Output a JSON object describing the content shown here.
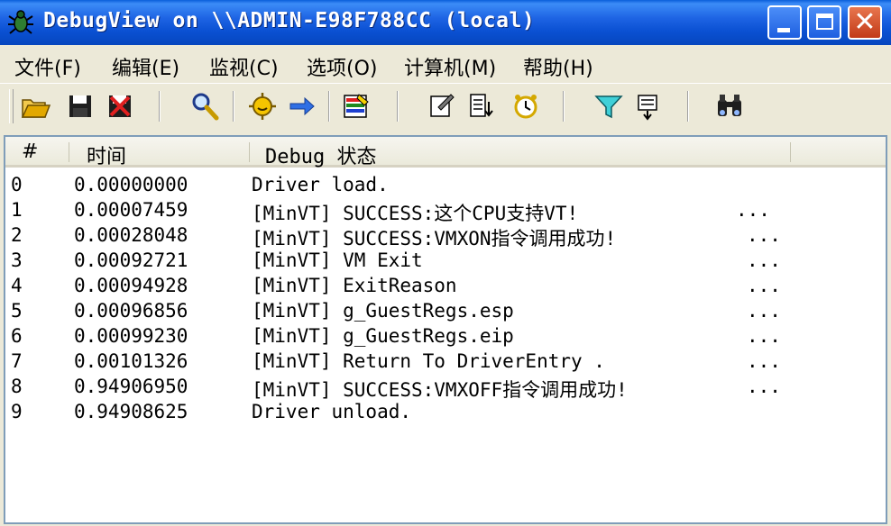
{
  "window": {
    "title": "DebugView on \\\\ADMIN-E98F788CC (local)"
  },
  "menu": [
    "文件(F)",
    "编辑(E)",
    "监视(C)",
    "选项(O)",
    "计算机(M)",
    "帮助(H)"
  ],
  "toolbar_icons": [
    "open-icon",
    "save-icon",
    "clear-icon",
    "find-icon",
    "capture-icon",
    "autoscroll-icon",
    "highlight-icon",
    "properties-icon",
    "log-to-file-icon",
    "clock-icon",
    "filter-icon",
    "history-icon",
    "binoculars-icon"
  ],
  "columns": [
    "#",
    "时间",
    "Debug 状态"
  ],
  "rows": [
    {
      "num": "0",
      "time": "0.00000000",
      "msg": "Driver load.",
      "more": ""
    },
    {
      "num": "1",
      "time": "0.00007459",
      "msg": " [MinVT] SUCCESS:这个CPU支持VT!",
      "more": "..."
    },
    {
      "num": "2",
      "time": "0.00028048",
      "msg": " [MinVT] SUCCESS:VMXON指令调用成功!",
      "more": "..."
    },
    {
      "num": "3",
      "time": "0.00092721",
      "msg": " [MinVT] VM Exit",
      "more": "..."
    },
    {
      "num": "4",
      "time": "0.00094928",
      "msg": " [MinVT] ExitReason",
      "more": "..."
    },
    {
      "num": "5",
      "time": "0.00096856",
      "msg": " [MinVT] g_GuestRegs.esp",
      "more": "..."
    },
    {
      "num": "6",
      "time": "0.00099230",
      "msg": " [MinVT] g_GuestRegs.eip",
      "more": "..."
    },
    {
      "num": "7",
      "time": "0.00101326",
      "msg": " [MinVT] Return To DriverEntry .",
      "more": "..."
    },
    {
      "num": "8",
      "time": "0.94906950",
      "msg": " [MinVT] SUCCESS:VMXOFF指令调用成功!",
      "more": "..."
    },
    {
      "num": "9",
      "time": "0.94908625",
      "msg": "Driver unload.",
      "more": ""
    }
  ]
}
